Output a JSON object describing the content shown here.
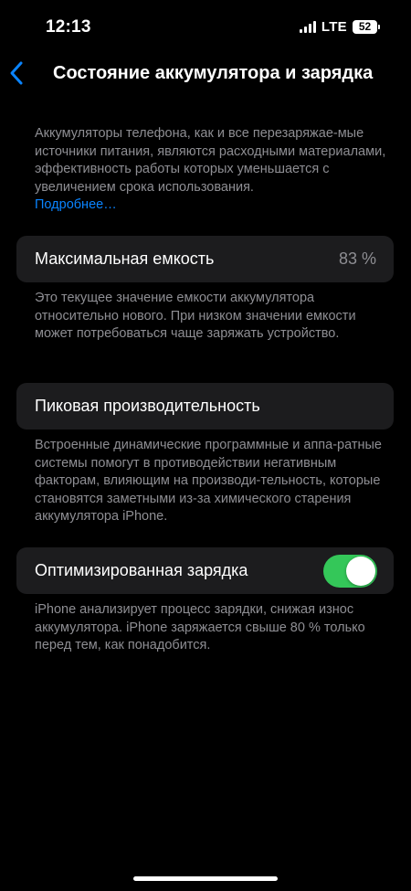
{
  "status_bar": {
    "time": "12:13",
    "network": "LTE",
    "battery_level": "52",
    "signal_bars": 4
  },
  "nav": {
    "back_icon": "chevron-left-icon",
    "title": "Состояние аккумулятора и зарядка"
  },
  "intro": {
    "text": "Аккумуляторы телефона, как и все перезаряжае-мые источники питания, являются расходными материалами, эффективность работы которых уменьшается с увеличением срока использования.",
    "link": "Подробнее…"
  },
  "max_capacity": {
    "label": "Максимальная емкость",
    "value": "83 %",
    "description": "Это текущее значение емкости аккумулятора относительно нового. При низком значении емкости может потребоваться чаще заряжать устройство."
  },
  "peak_performance": {
    "label": "Пиковая производительность",
    "description": "Встроенные динамические программные и аппа-ратные системы помогут в противодействии негативным факторам, влияющим на производи-тельность, которые становятся заметными из-за химического старения аккумулятора iPhone."
  },
  "optimized_charging": {
    "label": "Оптимизированная зарядка",
    "enabled": true,
    "description": "iPhone анализирует процесс зарядки, снижая износ аккумулятора. iPhone заряжается свыше 80 % только перед тем, как понадобится."
  },
  "colors": {
    "background": "#000000",
    "cell": "#1c1c1e",
    "secondary_text": "#8e8e93",
    "link": "#0a84ff",
    "toggle_on": "#34c759"
  }
}
